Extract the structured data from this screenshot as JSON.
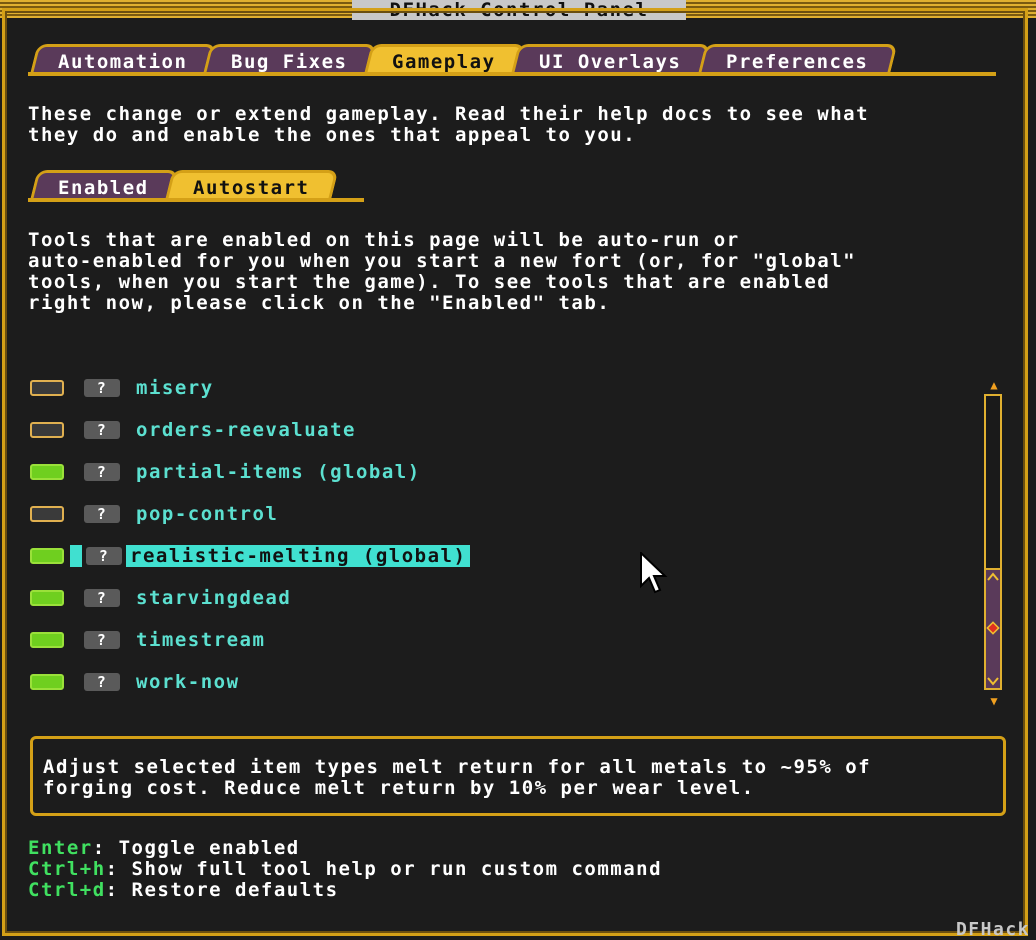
{
  "window": {
    "title": "DFHack Control Panel",
    "brand": "DFHack"
  },
  "main_tabs": [
    {
      "label": "Automation",
      "active": false
    },
    {
      "label": "Bug Fixes",
      "active": false
    },
    {
      "label": "Gameplay",
      "active": true
    },
    {
      "label": "UI Overlays",
      "active": false
    },
    {
      "label": "Preferences",
      "active": false
    }
  ],
  "intro_text": "These change or extend gameplay. Read their help docs to see what\nthey do and enable the ones that appeal to you.",
  "sub_tabs": [
    {
      "label": "Enabled",
      "active": false
    },
    {
      "label": "Autostart",
      "active": true
    }
  ],
  "autostart_text": "Tools that are enabled on this page will be auto-run or\nauto-enabled for you when you start a new fort (or, for \"global\"\ntools, when you start the game). To see tools that are enabled\nright now, please click on the \"Enabled\" tab.",
  "tools": [
    {
      "name": "misery",
      "enabled": false,
      "help": "?"
    },
    {
      "name": "orders-reevaluate",
      "enabled": false,
      "help": "?"
    },
    {
      "name": "partial-items (global)",
      "enabled": true,
      "help": "?"
    },
    {
      "name": "pop-control",
      "enabled": false,
      "help": "?"
    },
    {
      "name": "realistic-melting (global)",
      "enabled": true,
      "help": "?",
      "selected": true
    },
    {
      "name": "starvingdead",
      "enabled": true,
      "help": "?"
    },
    {
      "name": "timestream",
      "enabled": true,
      "help": "?"
    },
    {
      "name": "work-now",
      "enabled": true,
      "help": "?"
    }
  ],
  "description": "Adjust selected item types melt return for all metals to ~95% of\nforging cost. Reduce melt return by 10% per wear level.",
  "hotkeys": [
    {
      "key": "Enter",
      "action": ": Toggle enabled"
    },
    {
      "key": "Ctrl+h",
      "action": ": Show full tool help or run custom command"
    },
    {
      "key": "Ctrl+d",
      "action": ": Restore defaults"
    }
  ],
  "colors": {
    "accent": "#d4a017",
    "tab_bg": "#5a3a5a",
    "tab_active": "#f0c030",
    "tool_label": "#5ce0d0",
    "hotkey": "#40e060"
  }
}
